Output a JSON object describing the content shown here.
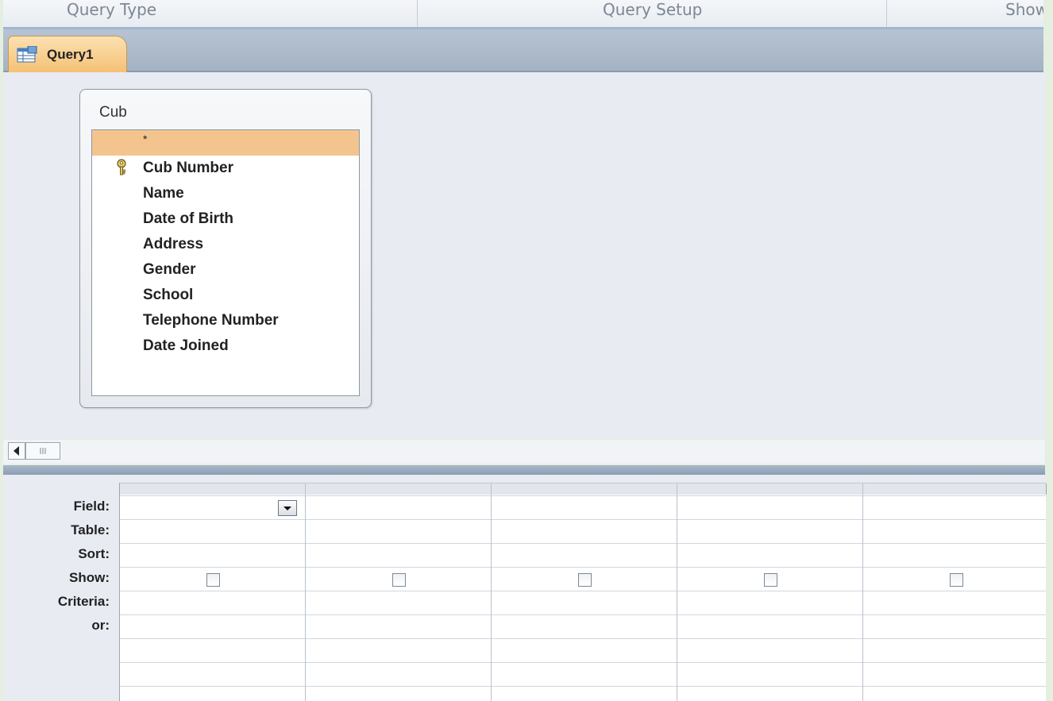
{
  "ribbon": {
    "groups": [
      "Query Type",
      "Query Setup",
      "Show"
    ]
  },
  "tab": {
    "label": "Query1",
    "icon": "query-icon"
  },
  "table": {
    "title": "Cub",
    "fields": [
      {
        "label": "*",
        "selected": true
      },
      {
        "label": "Cub Number",
        "primary_key": true,
        "icon": "key-icon"
      },
      {
        "label": "Name"
      },
      {
        "label": "Date of Birth"
      },
      {
        "label": "Address"
      },
      {
        "label": "Gender"
      },
      {
        "label": "School"
      },
      {
        "label": "Telephone Number"
      },
      {
        "label": "Date Joined"
      }
    ]
  },
  "scrollbar": {
    "left_icon": "arrow-left-icon",
    "thumb_icon": "grip-icon"
  },
  "grid": {
    "row_labels": [
      "Field:",
      "Table:",
      "Sort:",
      "Show:",
      "Criteria:",
      "or:"
    ],
    "column_count": 5
  },
  "colors": {
    "selected_row": "#f4c48f",
    "tab_active": "#f5c073",
    "ribbon_border": "#9fb7d2"
  }
}
